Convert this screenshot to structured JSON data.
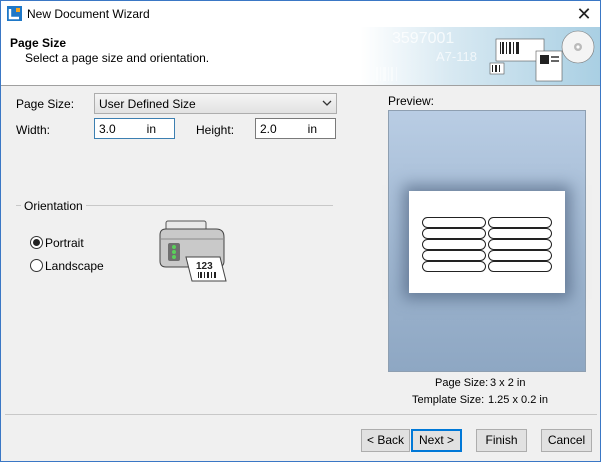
{
  "window": {
    "title": "New Document Wizard",
    "close_glyph": "✕"
  },
  "header": {
    "title": "Page Size",
    "subtitle": "Select a page size and orientation.",
    "art_text_1": "3597001",
    "art_text_2": "A7-118"
  },
  "form": {
    "page_size_label": "Page Size:",
    "page_size_value": "User Defined Size",
    "width_label": "Width:",
    "width_value": "3.0",
    "width_unit": "in",
    "height_label": "Height:",
    "height_value": "2.0",
    "height_unit": "in"
  },
  "orientation": {
    "title": "Orientation",
    "options": [
      {
        "label": "Portrait",
        "selected": true
      },
      {
        "label": "Landscape",
        "selected": false
      }
    ],
    "printer_label_text": "123"
  },
  "preview": {
    "label": "Preview:",
    "page_size_label": "Page Size:",
    "page_size_value": "3 x 2 in",
    "template_size_label": "Template Size:",
    "template_size_value": "1.25 x 0.2 in",
    "label_grid": {
      "rows": 5,
      "columns": 2
    }
  },
  "buttons": {
    "back": "< Back",
    "next": "Next >",
    "finish": "Finish",
    "cancel": "Cancel"
  },
  "colors": {
    "accent": "#0078d7",
    "preview_bg": "#9fb6d0",
    "window_border": "#3a77c5"
  },
  "icons": {
    "app": "label-wizard-icon",
    "dropdown": "chevron-down-icon",
    "printer": "label-printer-icon"
  }
}
